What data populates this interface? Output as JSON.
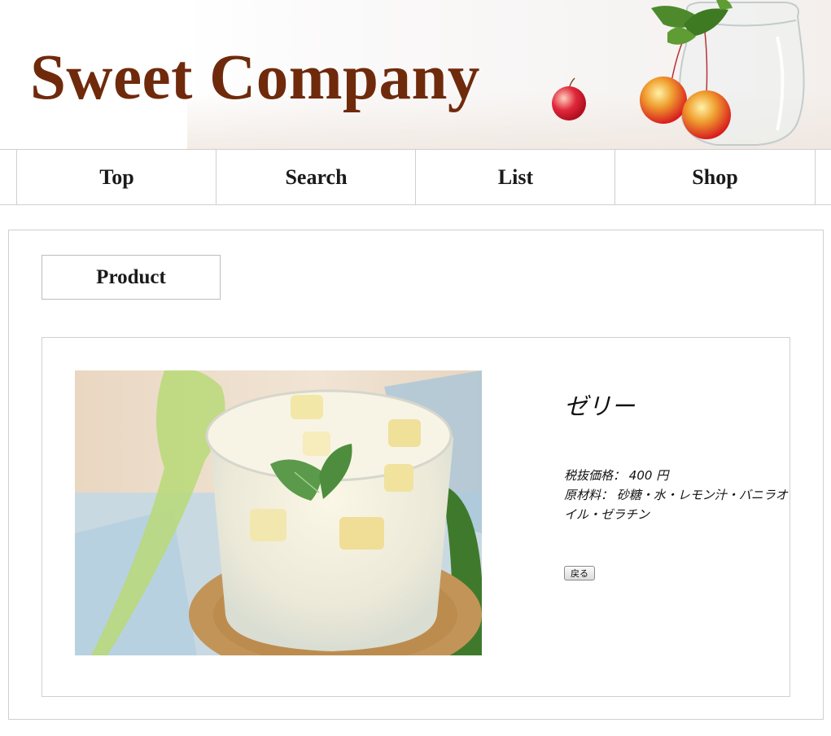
{
  "site": {
    "title": "Sweet Company"
  },
  "nav": {
    "items": [
      "Top",
      "Search",
      "List",
      "Shop"
    ]
  },
  "section": {
    "title": "Product"
  },
  "product": {
    "name": "ゼリー",
    "price_label": "税抜価格：",
    "price_value": "400 円",
    "ingredients_label": "原材料：",
    "ingredients_value": "砂糖・水・レモン汁・バニラオイル・ゼラチン",
    "back_label": "戻る"
  },
  "colors": {
    "brand": "#6f2a0c",
    "border": "#cfcfcf"
  }
}
